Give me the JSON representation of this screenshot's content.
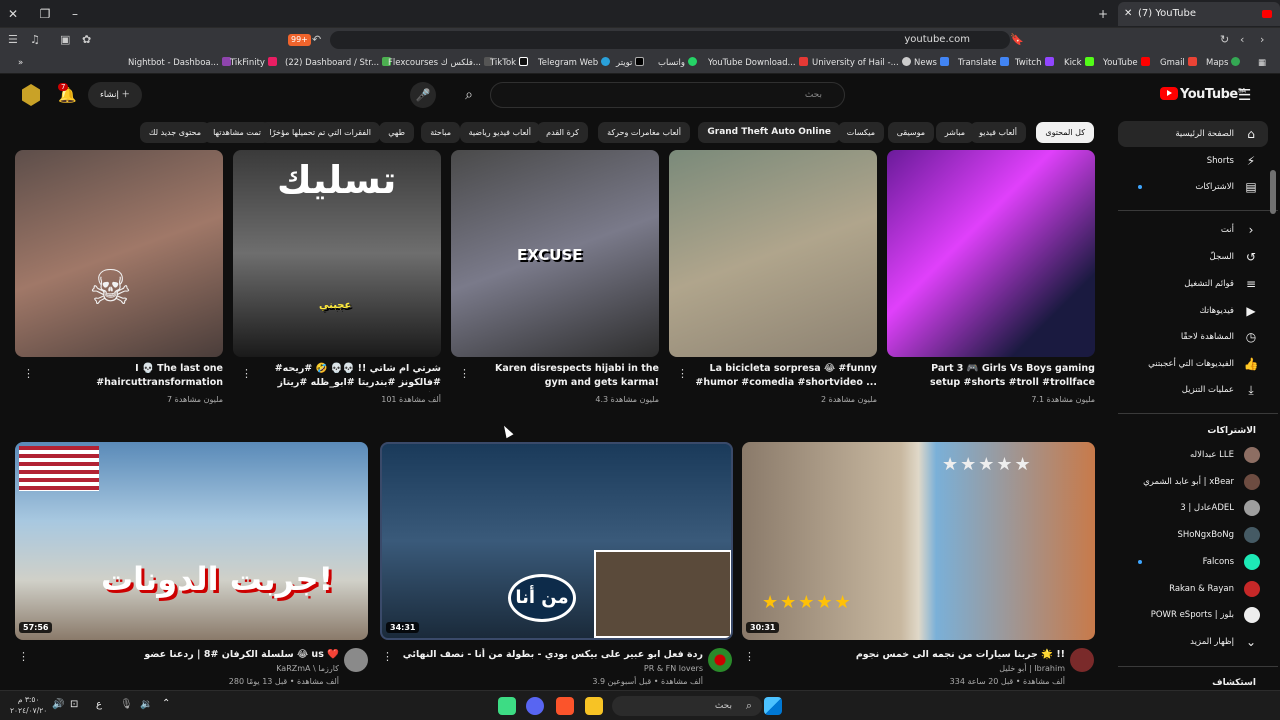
{
  "browser": {
    "tab_title": "(7) YouTube",
    "url": "youtube.com",
    "bookmarks": [
      "Nightbot - Dashboa...",
      "TikFinity",
      "(22) Dashboard / Str...",
      "Flexcourses فلكس ك...",
      "TikTok",
      "Telegram Web",
      "تويتر",
      "واتساب",
      "YouTube Download...",
      "University of Hail -...",
      "News",
      "Translate",
      "Twitch",
      "Kick",
      "YouTube",
      "Gmail",
      "Maps"
    ]
  },
  "header": {
    "logo": "YouTube",
    "logo_region": "SA",
    "search_placeholder": "بحث",
    "create_label": "إنشاء",
    "notif_count": "7"
  },
  "chips": [
    "كل المحتوى",
    "ألعاب فيديو",
    "مباشر",
    "موسيقى",
    "ميكسات",
    "Grand Theft Auto Online",
    "ألعاب مغامرات وحركة",
    "كرة القدم",
    "ألعاب فيديو رياضية",
    "مباحثة",
    "طهي",
    "الفقرات التي تم تحميلها مؤخرًا",
    "تمت مشاهدتها",
    "محتوى جديد لك"
  ],
  "sidebar": {
    "main": [
      "الصفحة الرئيسية",
      "Shorts",
      "الاشتراكات"
    ],
    "you_header": "أنت",
    "you_items": [
      "السجلّ",
      "قوائم التشغيل",
      "فيديوهاتك",
      "المشاهدة لاحقًا",
      "الفيديوهات التي أعجبتني",
      "عمليات التنزيل"
    ],
    "subs_header": "الاشتراكات",
    "subs": [
      "عبدالاله LLE",
      "أبو عابد الشمري | xBear",
      "عادل | 3ADEL",
      "SHoNgxBoNg",
      "Falcons",
      "Rakan & Rayan",
      "POWR eSports | بلوز"
    ],
    "show_more": "إظهار المزيد",
    "explore": "استكشاف"
  },
  "shorts": [
    {
      "title": "Part 3 🎮 Girls Vs Boys gaming setup #shorts #troll #trollface",
      "views": "7.1 مليون مشاهدة"
    },
    {
      "title": "La bicicleta sorpresa 😂 #funny #humor #comedia #shortvideo ...",
      "views": "2 مليون مشاهدة"
    },
    {
      "title": "Karen disrespects hijabi in the gym and gets karma!",
      "views": "4.3 مليون مشاهدة"
    },
    {
      "title": "#شرتي ام شاتي !! 💀💀 🤣 #ريحه #فالكونز #بندريتا #ابو_ظله #ريتاز #اكسبلور #ريزة",
      "views": "101 ألف مشاهدة"
    },
    {
      "title": "I 💀 The last one #haircuttransformation",
      "views": "7 مليون مشاهدة"
    }
  ],
  "short_overlays": {
    "excuse": "EXCUSE",
    "tasleek": "تسليك",
    "ajebni": "عجبني"
  },
  "videos": [
    {
      "title": "جربنا سيارات من نجمه الى خمس نجوم 🌟 !!",
      "channel": "أبو خليل | Ibrahim",
      "meta": "334 ألف مشاهدة • قبل 20 ساعة",
      "duration": "30:31"
    },
    {
      "title": "ردة فعل ابو عبير على بيكس بودي - بطولة من أنا - نصف النهائي ( لقاء الشباب 😏 )",
      "channel": "PR & FN lovers",
      "meta": "3.9 ألف مشاهدة • قبل أسبوعين",
      "duration": "34:31",
      "overlay": "من أنا"
    },
    {
      "title": "سلسلة الكرفان #8 | ردعنا عضو 😂 us ❤️",
      "channel": "KaRZmA \\ كارزما",
      "meta": "280 ألف مشاهدة • قبل 13 يومًا",
      "duration": "57:56",
      "overlay": "جربت الدونات!"
    }
  ],
  "taskbar": {
    "search": "بحث",
    "time": "٣:٥٠ م",
    "date": "٢٠٢٤/٠٧/٢٠",
    "lang": "ع"
  }
}
